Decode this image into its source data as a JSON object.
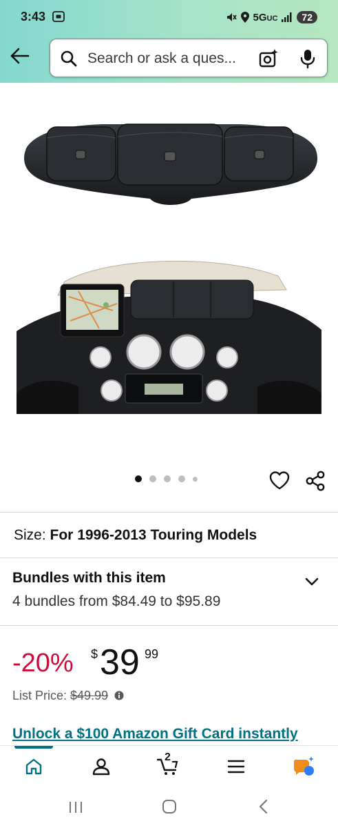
{
  "status_bar": {
    "time": "3:43",
    "network": "5G",
    "network_suffix": "UC",
    "battery": "72"
  },
  "search": {
    "placeholder": "Search or ask a ques..."
  },
  "gallery": {
    "image_count": 5,
    "active_index": 0
  },
  "size": {
    "label": "Size: ",
    "value": "For 1996-2013 Touring Models"
  },
  "bundles": {
    "title": "Bundles with this item",
    "subtitle": "4 bundles from $84.49 to $95.89"
  },
  "price": {
    "discount": "-20%",
    "currency": "$",
    "whole": "39",
    "fraction": "99"
  },
  "list_price": {
    "label": "List Price: ",
    "value": "$49.99"
  },
  "promo": {
    "text": "Unlock a $100 Amazon Gift Card instantly"
  },
  "bottom_nav": {
    "cart_count": "2",
    "active": "home",
    "accent_color": "#007185"
  },
  "colors": {
    "header_gradient_start": "#83d8d0",
    "header_gradient_end": "#b6e7bf",
    "discount_red": "#cc0c39",
    "link_teal": "#007185"
  }
}
